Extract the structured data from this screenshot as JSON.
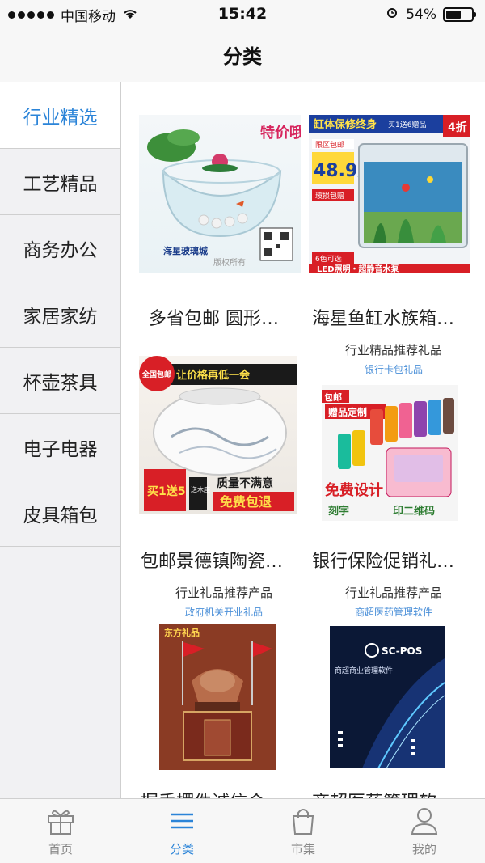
{
  "status_bar": {
    "carrier": "中国移动",
    "time": "15:42",
    "battery": "54%"
  },
  "nav": {
    "title": "分类"
  },
  "sidebar": {
    "items": [
      {
        "label": "行业精选",
        "active": true
      },
      {
        "label": "工艺精品",
        "active": false
      },
      {
        "label": "商务办公",
        "active": false
      },
      {
        "label": "家居家纺",
        "active": false
      },
      {
        "label": "杯壶茶具",
        "active": false
      },
      {
        "label": "电子电器",
        "active": false
      },
      {
        "label": "皮具箱包",
        "active": false
      }
    ]
  },
  "products": [
    {
      "name": "多省包邮 圆形…",
      "image_text": [
        "特价哦!",
        "海星玻璃城",
        "版权所有"
      ]
    },
    {
      "name": "海星鱼缸水族箱…",
      "image_text": [
        "缸体保修终身",
        "买1送6赠品",
        "4折",
        "限区包邮",
        "48.9元",
        "玻损包赔",
        "6色可选",
        "LED照明・超静音水泵"
      ]
    },
    {
      "name": "包邮景德镇陶瓷…",
      "image_text": [
        "全国包邮",
        "让价格再低一会",
        "买1送5",
        "送木座",
        "质量不满意",
        "免费包退"
      ]
    },
    {
      "name": "银行保险促销礼…",
      "promo_title": "行业精品推荐礼品",
      "promo_sub": "银行卡包礼品",
      "image_text": [
        "包邮",
        "赠品定制",
        "免费设计",
        "刻字",
        "印二维码"
      ]
    },
    {
      "name": "握手摆件诚信合…",
      "promo_title": "行业礼品推荐产品",
      "promo_sub": "政府机关开业礼品",
      "image_text": [
        "东方礼品"
      ]
    },
    {
      "name": "商超医药管理软…",
      "promo_title": "行业礼品推荐产品",
      "promo_sub": "商超医药管理软件",
      "image_text": [
        "SC-POS",
        "商超商业管理软件"
      ]
    }
  ],
  "tabbar": {
    "tabs": [
      {
        "label": "首页",
        "icon": "gift-icon",
        "active": false
      },
      {
        "label": "分类",
        "icon": "menu-lines-icon",
        "active": true
      },
      {
        "label": "市集",
        "icon": "shopping-bag-icon",
        "active": false
      },
      {
        "label": "我的",
        "icon": "person-icon",
        "active": false
      }
    ]
  },
  "colors": {
    "accent": "#2b84d8",
    "sidebar_bg": "#f1f1f3",
    "bar_bg": "#f7f7f7"
  }
}
